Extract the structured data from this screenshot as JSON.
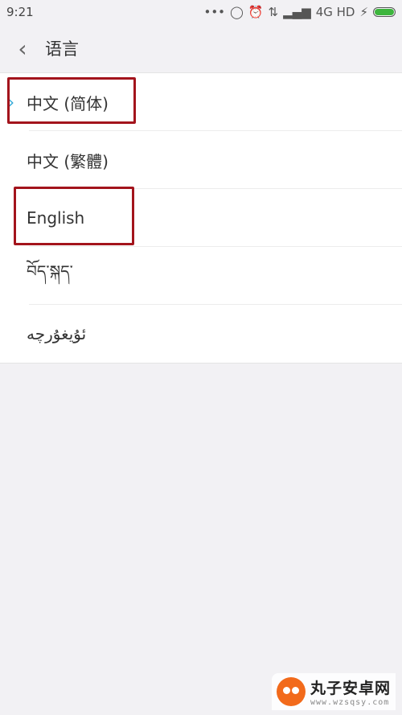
{
  "status_bar": {
    "time": "9:21",
    "icons": [
      "more-dots-icon",
      "sync-icon",
      "alarm-icon",
      "data-transfer-icon",
      "signal-icon"
    ],
    "network": "4G HD",
    "charging": "⚡",
    "battery_level": 1.0
  },
  "header": {
    "back_icon": "‹",
    "title": "语言"
  },
  "languages": [
    {
      "label": "中文 (简体)",
      "selected": true
    },
    {
      "label": "中文 (繁體)",
      "selected": false
    },
    {
      "label": "English",
      "selected": false
    },
    {
      "label": "བོད་སྐད་",
      "selected": false
    },
    {
      "label": "ئۇيغۇرچە",
      "selected": false
    }
  ],
  "check_glyph": "›",
  "watermark": {
    "name": "丸子安卓网",
    "url": "www.wzsqsy.com"
  },
  "colors": {
    "accent": "#34a7d6",
    "highlight_box": "#a3141c",
    "battery": "#3db53d"
  }
}
